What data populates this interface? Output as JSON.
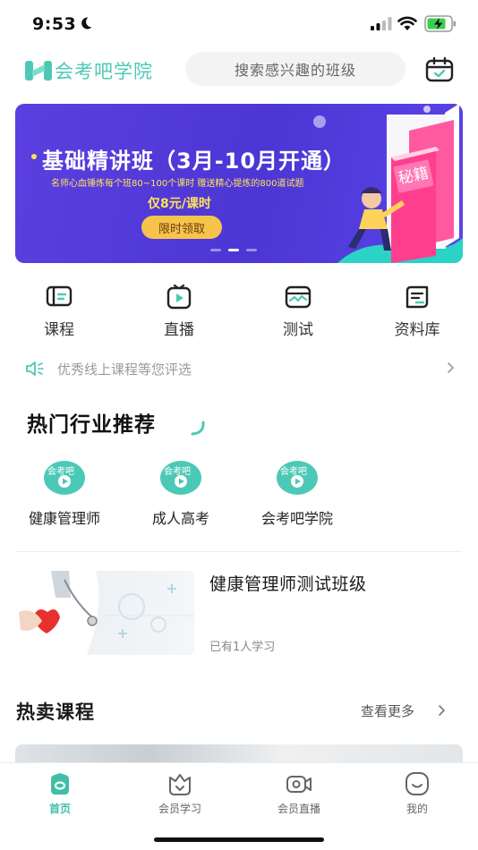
{
  "status": {
    "time": "9:53"
  },
  "header": {
    "logo_text": "会考吧学院",
    "search_placeholder": "搜索感兴趣的班级",
    "icons": {
      "logo": "logo-mark-icon",
      "calendar": "calendar-check-icon"
    }
  },
  "banner": {
    "title": "基础精讲班（3月-10月开通）",
    "subtitle": "名师心血锤炼每个班80~100个课时 赠送精心提炼的800道试题",
    "price": "仅8元/课时",
    "button": "限时领取",
    "badge": "秘籍",
    "pages": 3,
    "active_page": 2
  },
  "quick_nav": [
    {
      "label": "课程",
      "icon": "course-book-icon"
    },
    {
      "label": "直播",
      "icon": "live-play-icon"
    },
    {
      "label": "测试",
      "icon": "test-screen-icon"
    },
    {
      "label": "资料库",
      "icon": "document-library-icon"
    }
  ],
  "notice": {
    "text": "优秀线上课程等您评选",
    "icon": "speaker-icon"
  },
  "hot_industry": {
    "title": "热门行业推荐",
    "items": [
      {
        "label": "健康管理师",
        "icon": "video-play-badge-icon"
      },
      {
        "label": "成人高考",
        "icon": "video-play-badge-icon"
      },
      {
        "label": "会考吧学院",
        "icon": "video-play-badge-icon"
      }
    ]
  },
  "class_card": {
    "title": "健康管理师测试班级",
    "meta": "已有1人学习"
  },
  "hot_sale": {
    "title": "热卖课程",
    "more": "查看更多"
  },
  "tabbar": [
    {
      "label": "首页",
      "icon": "home-icon",
      "active": true
    },
    {
      "label": "会员学习",
      "icon": "member-crown-icon",
      "active": false
    },
    {
      "label": "会员直播",
      "icon": "video-camera-icon",
      "active": false
    },
    {
      "label": "我的",
      "icon": "smile-profile-icon",
      "active": false
    }
  ],
  "colors": {
    "brand": "#4cc9b6",
    "active_tab": "#3fbfa7",
    "banner_bg": "#4c36d4",
    "banner_accent": "#ffe35a"
  }
}
